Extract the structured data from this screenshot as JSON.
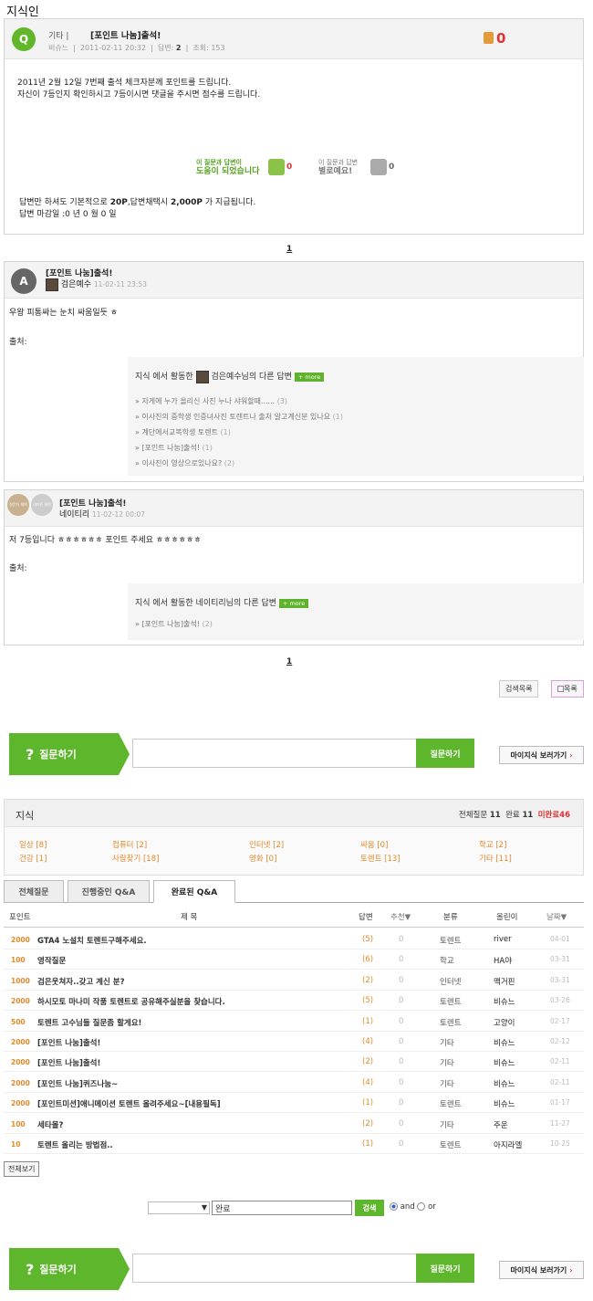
{
  "page": {
    "title": "지식인"
  },
  "question": {
    "badge": "Q",
    "category": "기타 |",
    "title": "[포인트 나눔]출석!",
    "author": "비슈느",
    "date": "2011-02-11 20:32",
    "answers_label": "답변:",
    "answers": "2",
    "views_label": "조회:",
    "views": "153",
    "good_count": "0",
    "body_line1": "2011년 2월 12일 7번째 출석 체크자분께 포인트를 드립니다.",
    "body_line2": "자신이 7등인지 확인하시고 7등이시면 댓글을 주시면 점수를 드립니다.",
    "helpful_small": "이 질문과 답변이",
    "helpful_big": "도움이 되었습니다",
    "helpful_count": "0",
    "unhelpful_small": "이 질문과 답변",
    "unhelpful_big": "별로예요!",
    "unhelpful_count": "0",
    "reward_prefix": "답변만 하셔도 기본적으로",
    "reward_pts": "20P",
    "reward_mid": ",답변채택시",
    "reward_big": "2,000P",
    "reward_suffix": "가 지급됩니다.",
    "deadline": "답변 마감일 :0 년 0 월 0 일"
  },
  "pager_top": "1",
  "answer1": {
    "badge": "A",
    "title": "[포인트 나눔]출석!",
    "nick": "검은예수",
    "date": "11-02-11 23:53",
    "body": "우왕 피통싸는 눈치 싸움일듯 ㅎ",
    "source": "출처:",
    "related_title": "지식 에서 활동한",
    "related_nick": "검은예수님의 다른 답변",
    "more": "+ more",
    "items": [
      {
        "text": "자게에 누가 올리신 사진 누나 샤워할때......",
        "count": "(3)"
      },
      {
        "text": "이사진의 중학생 인증녀사진 토렌트나 출처 알고계신분 있나요",
        "count": "(1)"
      },
      {
        "text": "계단에서교복학생 토렌트",
        "count": "(1)"
      },
      {
        "text": "[포인트 나눔]출석!",
        "count": "(1)"
      },
      {
        "text": "이사진이 영상으로있나요?",
        "count": "(2)"
      }
    ]
  },
  "answer2": {
    "badge1": "질문자 채택",
    "badge2": "네티즌 채택",
    "title": "[포인트 나눔]출석!",
    "nick": "네이티리",
    "date": "11-02-12 00:07",
    "body": "저 7등입니다 ㅎㅎㅎㅎㅎㅎ 포인트 주세요 ㅎㅎㅎㅎㅎㅎ",
    "source": "출처:",
    "related_title": "지식 에서 활동한 네이티리님의 다른 답변",
    "more": "+ more",
    "items": [
      {
        "text": "[포인트 나눔]출석!",
        "count": "(2)"
      }
    ]
  },
  "pager_bottom": "1",
  "buttons": {
    "search_list": "검색목록",
    "list": "목록"
  },
  "askbar": {
    "label": "질문하기",
    "submit": "질문하기",
    "my": "마이지식 보러가기"
  },
  "jisik": {
    "title": "지식",
    "total_label": "전체질문",
    "total": "11",
    "done_label": "완료",
    "done": "11",
    "undone": "미완료46",
    "categories": [
      {
        "name": "일상",
        "count": "[8]"
      },
      {
        "name": "컴퓨터",
        "count": "[2]"
      },
      {
        "name": "인터넷",
        "count": "[2]"
      },
      {
        "name": "싸움",
        "count": "[0]"
      },
      {
        "name": "학교",
        "count": "[2]"
      },
      {
        "name": "건강",
        "count": "[1]"
      },
      {
        "name": "사람찾기",
        "count": "[18]"
      },
      {
        "name": "영화",
        "count": "[0]"
      },
      {
        "name": "토렌트",
        "count": "[13]"
      },
      {
        "name": "기타",
        "count": "[11]"
      }
    ]
  },
  "tabs": [
    "전체질문",
    "진행중인 Q&A",
    "완료된 Q&A"
  ],
  "table": {
    "headers": {
      "point": "포인트",
      "title": "제 목",
      "answers": "답변",
      "recommend": "추천▼",
      "category": "분류",
      "user": "올린이",
      "date": "날짜▼"
    },
    "rows": [
      {
        "point": "2000",
        "title": "GTA4 노설치 토렌트구해주세요.",
        "answers": "(5)",
        "rec": "0",
        "cat": "토렌트",
        "user": "river",
        "date": "04-01"
      },
      {
        "point": "100",
        "title": "영작질문",
        "answers": "(6)",
        "rec": "0",
        "cat": "학교",
        "user": "HA야",
        "date": "03-31"
      },
      {
        "point": "1000",
        "title": "검은웃쳐자..갖고 계신 분?",
        "answers": "(2)",
        "rec": "0",
        "cat": "인터넷",
        "user": "맥거핀",
        "date": "03-31"
      },
      {
        "point": "2000",
        "title": "하시모토 마나미 작품 토렌트로 공유해주실분을 찾습니다.",
        "answers": "(5)",
        "rec": "0",
        "cat": "토렌트",
        "user": "비슈느",
        "date": "03-26"
      },
      {
        "point": "500",
        "title": "토렌트 고수님들 질문좀 할게요!",
        "answers": "(1)",
        "rec": "0",
        "cat": "토렌트",
        "user": "고양이",
        "date": "02-17"
      },
      {
        "point": "2000",
        "title": "[포인트 나눔]출석!",
        "answers": "(4)",
        "rec": "0",
        "cat": "기타",
        "user": "비슈느",
        "date": "02-12"
      },
      {
        "point": "2000",
        "title": "[포인트 나눔]출석!",
        "answers": "(2)",
        "rec": "0",
        "cat": "기타",
        "user": "비슈느",
        "date": "02-11"
      },
      {
        "point": "2000",
        "title": "[포인트 나눔]퀴즈나눔~",
        "answers": "(4)",
        "rec": "0",
        "cat": "기타",
        "user": "비슈느",
        "date": "02-11"
      },
      {
        "point": "2000",
        "title": "[포인트미션]애니메이션 토렌트 올려주세요~[내용필독]",
        "answers": "(1)",
        "rec": "0",
        "cat": "토렌트",
        "user": "비슈느",
        "date": "01-17"
      },
      {
        "point": "100",
        "title": "세타몰?",
        "answers": "(2)",
        "rec": "0",
        "cat": "기타",
        "user": "주운",
        "date": "11-27"
      },
      {
        "point": "10",
        "title": "토렌트 올리는 방법점..",
        "answers": "(1)",
        "rec": "0",
        "cat": "토렌트",
        "user": "아지라엘",
        "date": "10-25"
      }
    ]
  },
  "view_all": "전체보기",
  "search": {
    "query": "완료",
    "button": "검색",
    "and": "and",
    "or": "or"
  }
}
